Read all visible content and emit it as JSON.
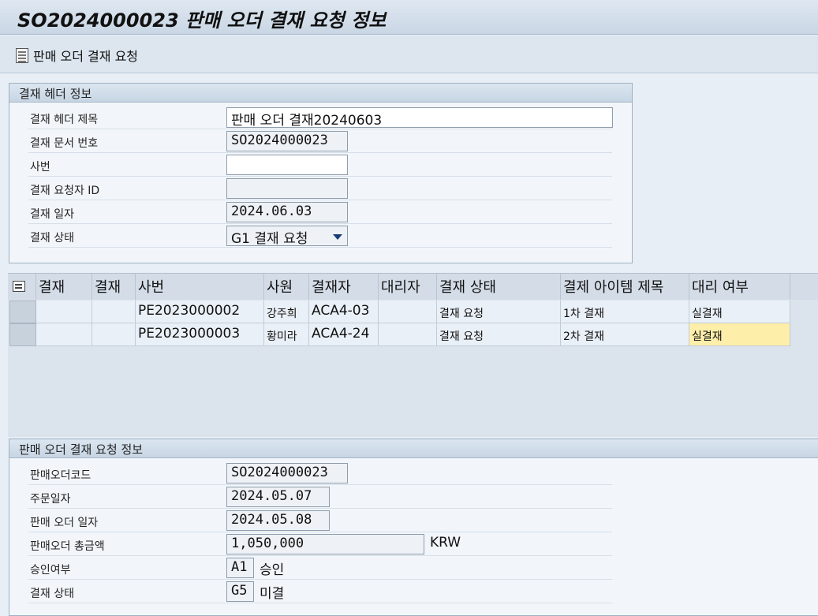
{
  "window": {
    "title": "SO2024000023 판매 오더 결재 요청 정보"
  },
  "toolbar": {
    "request_button_label": "판매 오더 결재 요청"
  },
  "header_group": {
    "title": "결재 헤더 정보",
    "fields": [
      {
        "label": "결재 헤더 제목",
        "value": "판매 오더 결재20240603"
      },
      {
        "label": "결재 문서 번호",
        "value": "SO2024000023"
      },
      {
        "label": "사번",
        "value": ""
      },
      {
        "label": "결재 요청자 ID",
        "value": ""
      },
      {
        "label": "결재 일자",
        "value": "2024.06.03"
      },
      {
        "label": "결재 상태",
        "value": "G1 결재 요청"
      }
    ]
  },
  "approval_grid": {
    "columns": [
      "결재",
      "결재",
      "사번",
      "사원",
      "결재자",
      "대리자",
      "결재 상태",
      "결제 아이템 제목",
      "대리 여부"
    ],
    "rows": [
      {
        "c1": "",
        "c2": "",
        "emp_no": "PE2023000002",
        "employee": "강주희",
        "approver": "ACA4-03",
        "proxy": "",
        "status": "결재 요청",
        "item_title": "1차 결재",
        "proxy_flag": "실결재"
      },
      {
        "c1": "",
        "c2": "",
        "emp_no": "PE2023000003",
        "employee": "황미라",
        "approver": "ACA4-24",
        "proxy": "",
        "status": "결재 요청",
        "item_title": "2차 결재",
        "proxy_flag": "실결재"
      }
    ]
  },
  "order_group": {
    "title": "판매 오더 결재 요청 정보",
    "fields": [
      {
        "label": "판매오더코드",
        "value": "SO2024000023",
        "suffix": ""
      },
      {
        "label": "주문일자",
        "value": "2024.05.07",
        "suffix": ""
      },
      {
        "label": "판매 오더 일자",
        "value": "2024.05.08",
        "suffix": ""
      },
      {
        "label": "판매오더 총금액",
        "value": "1,050,000",
        "suffix": "KRW"
      },
      {
        "label": "승인여부",
        "value": "A1",
        "suffix": "승인"
      },
      {
        "label": "결재 상태",
        "value": "G5",
        "suffix": "미결"
      }
    ]
  }
}
